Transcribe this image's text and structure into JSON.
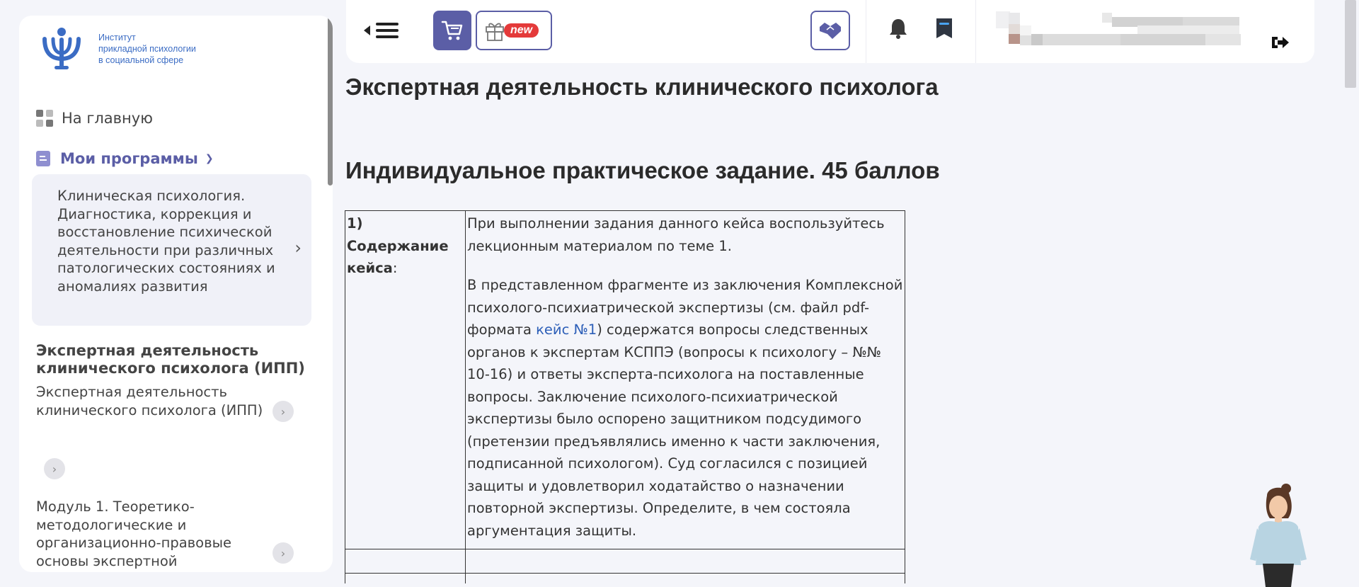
{
  "sidebar": {
    "logo_lines": [
      "Институт",
      "прикладной психологии",
      "в социальной сфере"
    ],
    "home_label": "На главную",
    "programs_label": "Мои программы",
    "program_card_text": "Клиническая психология. Диагностика, коррекция и восстановление психической деятельности при различных патологических состояниях и аномалиях развития",
    "section_title": "Экспертная деятельность клинического психолога (ИПП)",
    "sub_item_1": "Экспертная деятельность клинического психолога (ИПП)",
    "sub_item_2": "Модуль 1. Теоретико-методологические и организационно-правовые основы экспертной"
  },
  "topbar": {
    "new_badge": "new",
    "colors": {
      "accent": "#5b5ea6",
      "badge": "#e43a3a"
    }
  },
  "main": {
    "page_title": "Экспертная деятельность клинического психолога",
    "task_title": "Индивидуальное практическое задание. 45 баллов",
    "table": {
      "label_bold": "1) Содержание кейса",
      "label_suffix": ":",
      "para1": "При выполнении задания данного кейса воспользуйтесь лекционным материалом по теме 1.",
      "para2_before": "В представленном фрагменте из заключения Комплексной психолого-психиатрической экспертизы (см. файл pdf-формата ",
      "para2_link": "кейс №1",
      "para2_after": ") содержатся вопросы следственных органов к экспертам  КСППЭ (вопросы к психологу – №№ 10-16) и ответы эксперта-психолога на поставленные вопросы. Заключение психолого-психиатрической экспертизы было оспорено защитником подсудимого (претензии предъявлялись именно к части заключения, подписанной психологом). Суд согласился с позицией защиты и удовлетворил ходатайство о назначении повторной экспертизы. Определите, в чем состояла аргументация защиты."
    }
  },
  "icons": {
    "menu": "hamburger-icon",
    "cart": "cart-icon",
    "gift": "gift-icon",
    "partner": "handshake-icon",
    "bell": "bell-icon",
    "messages": "message-icon",
    "logout": "logout-icon"
  }
}
